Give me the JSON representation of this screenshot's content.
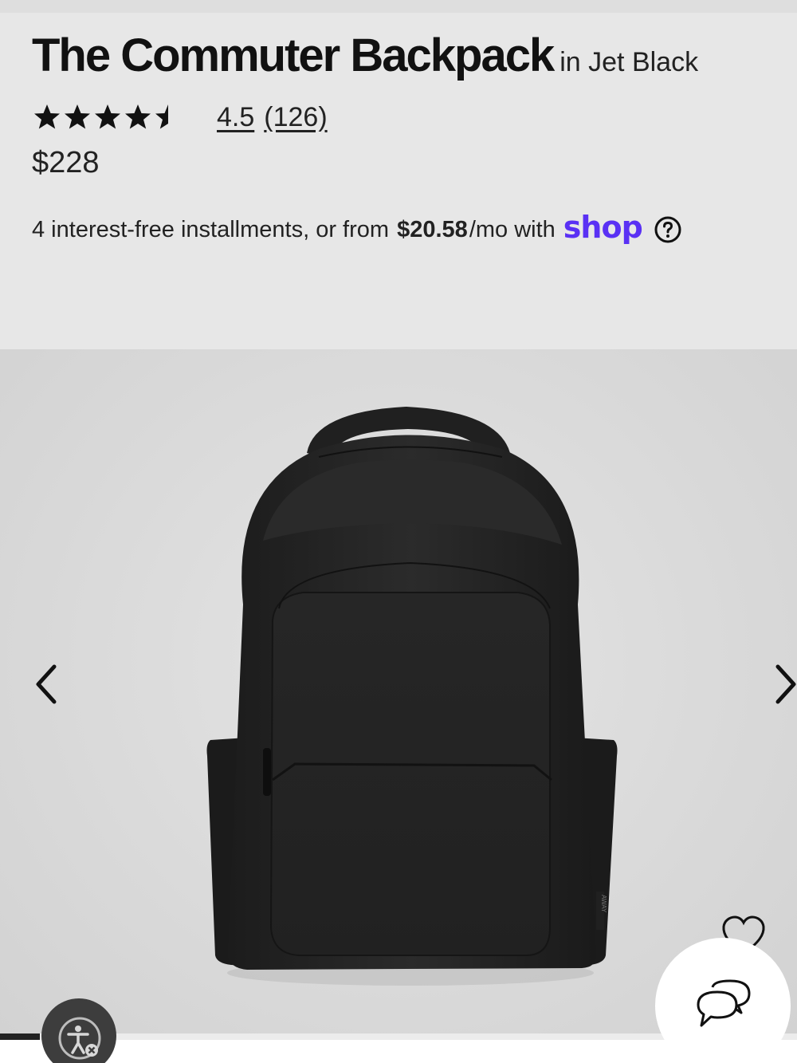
{
  "product": {
    "title": "The Commuter Backpack",
    "variant": "in Jet Black",
    "rating_value": 4.5,
    "rating_text": "4.5",
    "review_count_text": "(126)",
    "price": "$228"
  },
  "installments": {
    "prefix": "4 interest-free installments, or from",
    "amount": "$20.58",
    "suffix": "/mo with",
    "provider": "shop"
  },
  "gallery": {
    "image_brand_tag": "AWAY"
  },
  "colors": {
    "shop_brand": "#5a31f4",
    "text": "#141414",
    "background": "#e7e7e7"
  },
  "icons": {
    "prev": "chevron-left-icon",
    "next": "chevron-right-icon",
    "wishlist": "heart-icon",
    "chat": "chat-bubbles-icon",
    "accessibility": "accessibility-icon",
    "help": "question-circle-icon"
  },
  "carousel": {
    "progress": 0.05
  }
}
